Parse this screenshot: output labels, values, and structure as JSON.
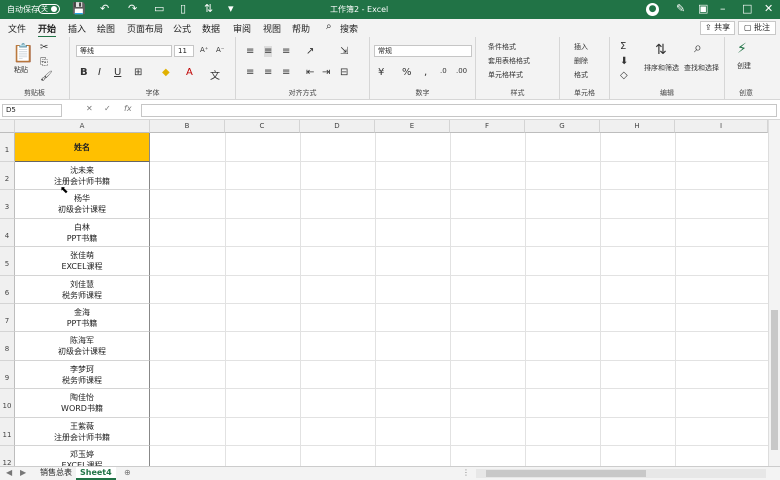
{
  "titlebar": {
    "autosave": "自动保存",
    "autosave_state": "关",
    "doc_title": "工作簿2 - Excel"
  },
  "menu": {
    "tabs": [
      "文件",
      "开始",
      "插入",
      "绘图",
      "页面布局",
      "公式",
      "数据",
      "审阅",
      "视图",
      "帮助"
    ],
    "active_tab": "开始",
    "search": "搜索",
    "share": "共享",
    "comments": "批注"
  },
  "ribbon": {
    "clipboard": {
      "paste": "粘贴",
      "label": "剪贴板"
    },
    "font": {
      "name": "等线",
      "size": "11",
      "label": "字体"
    },
    "alignment": {
      "label": "对齐方式"
    },
    "number": {
      "format": "常规",
      "label": "数字"
    },
    "styles": {
      "conditional": "条件格式",
      "table": "套用表格格式",
      "cell": "单元格样式",
      "label": "样式"
    },
    "cells": {
      "insert": "插入",
      "delete": "删除",
      "format": "格式",
      "label": "单元格"
    },
    "editing": {
      "sort": "排序和筛选",
      "find": "查找和选择",
      "label": "编辑"
    },
    "create": {
      "btn": "创建",
      "label": "创意"
    }
  },
  "formula": {
    "namebox": "D5",
    "fx": "fx"
  },
  "grid": {
    "columns": [
      "A",
      "B",
      "C",
      "D",
      "E",
      "F",
      "G",
      "H",
      "I"
    ],
    "header_cell": "姓名",
    "rows": [
      {
        "num": "1",
        "name": "姓名",
        "course": ""
      },
      {
        "num": "2",
        "name": "沈未来",
        "course": "注册会计师书籍"
      },
      {
        "num": "3",
        "name": "杨华",
        "course": "初级会计课程"
      },
      {
        "num": "4",
        "name": "白林",
        "course": "PPT书籍"
      },
      {
        "num": "5",
        "name": "张佳萌",
        "course": "EXCEL课程"
      },
      {
        "num": "6",
        "name": "刘佳慧",
        "course": "税务师课程"
      },
      {
        "num": "7",
        "name": "金海",
        "course": "PPT书籍"
      },
      {
        "num": "8",
        "name": "陈海军",
        "course": "初级会计课程"
      },
      {
        "num": "9",
        "name": "李梦珂",
        "course": "税务师课程"
      },
      {
        "num": "10",
        "name": "陶佳怡",
        "course": "WORD书籍"
      },
      {
        "num": "11",
        "name": "王紫薇",
        "course": "注册会计师书籍"
      },
      {
        "num": "12",
        "name": "邓玉婷",
        "course": "EXCEL课程"
      }
    ]
  },
  "sheets": {
    "tabs": [
      "销售总表",
      "Sheet4"
    ],
    "active": "Sheet4"
  },
  "colors": {
    "excel_green": "#217346",
    "header_fill": "#ffc000"
  }
}
